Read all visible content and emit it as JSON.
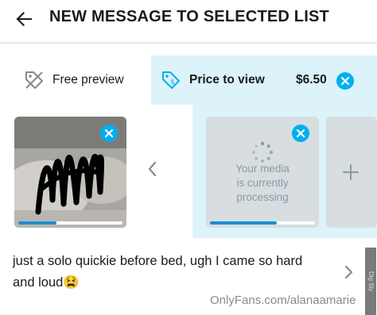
{
  "header": {
    "title": "NEW MESSAGE TO SELECTED LIST"
  },
  "tabs": {
    "free_preview": "Free preview",
    "price_to_view": "Price to view",
    "price": "$6.50"
  },
  "media": {
    "preview_progress": 0.37,
    "processing_text": [
      "Your media",
      "is currently",
      "processing"
    ],
    "processing_progress": 0.64
  },
  "caption": {
    "text": "just a solo quickie before bed, ugh I came so hard and loud😫"
  },
  "watermark": {
    "text": "OnlyFans.com/alanaamarie",
    "side_text": "Dig Sly"
  },
  "colors": {
    "accent": "#00aff0",
    "panel_bg": "#dcf3f9",
    "progress": "#1a8fd6"
  }
}
